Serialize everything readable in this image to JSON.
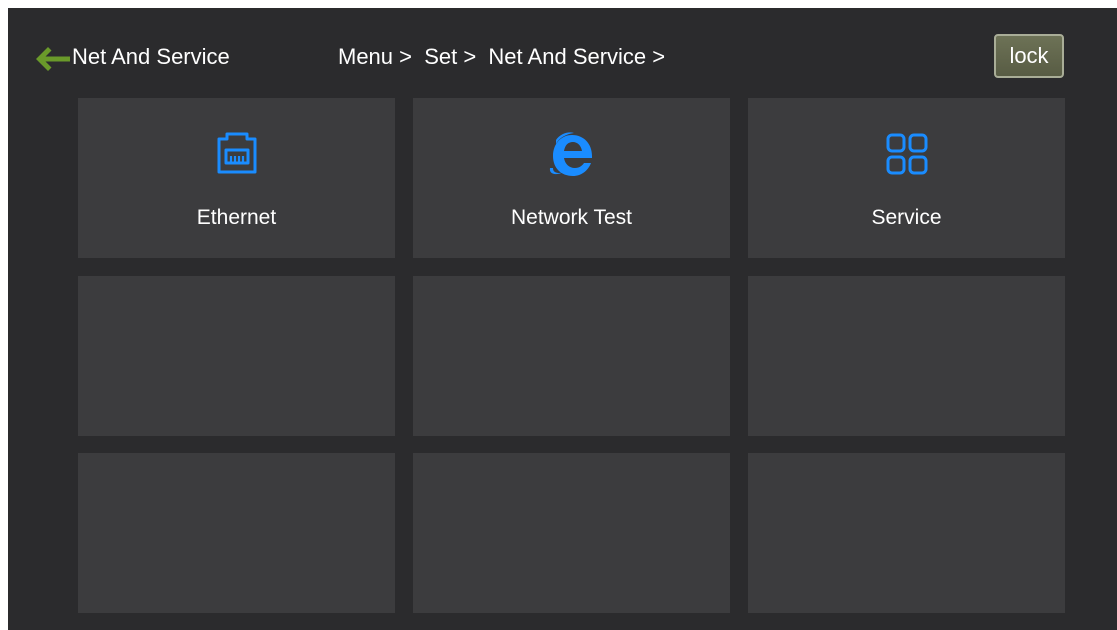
{
  "header": {
    "title": "Net And Service",
    "breadcrumb": "Menu >  Set >  Net And Service >",
    "lock_label": "lock",
    "back_icon": "arrow-left-icon"
  },
  "tiles": [
    {
      "label": "Ethernet",
      "icon": "ethernet-port-icon"
    },
    {
      "label": "Network Test",
      "icon": "internet-explorer-icon"
    },
    {
      "label": "Service",
      "icon": "grid-apps-icon"
    },
    {
      "label": ""
    },
    {
      "label": ""
    },
    {
      "label": ""
    },
    {
      "label": ""
    },
    {
      "label": ""
    },
    {
      "label": ""
    }
  ],
  "colors": {
    "background": "#2b2b2d",
    "tile": "#3c3c3e",
    "icon_accent": "#1a8cff",
    "back_arrow": "#6a9a2a",
    "lock_button": "#62674d"
  }
}
